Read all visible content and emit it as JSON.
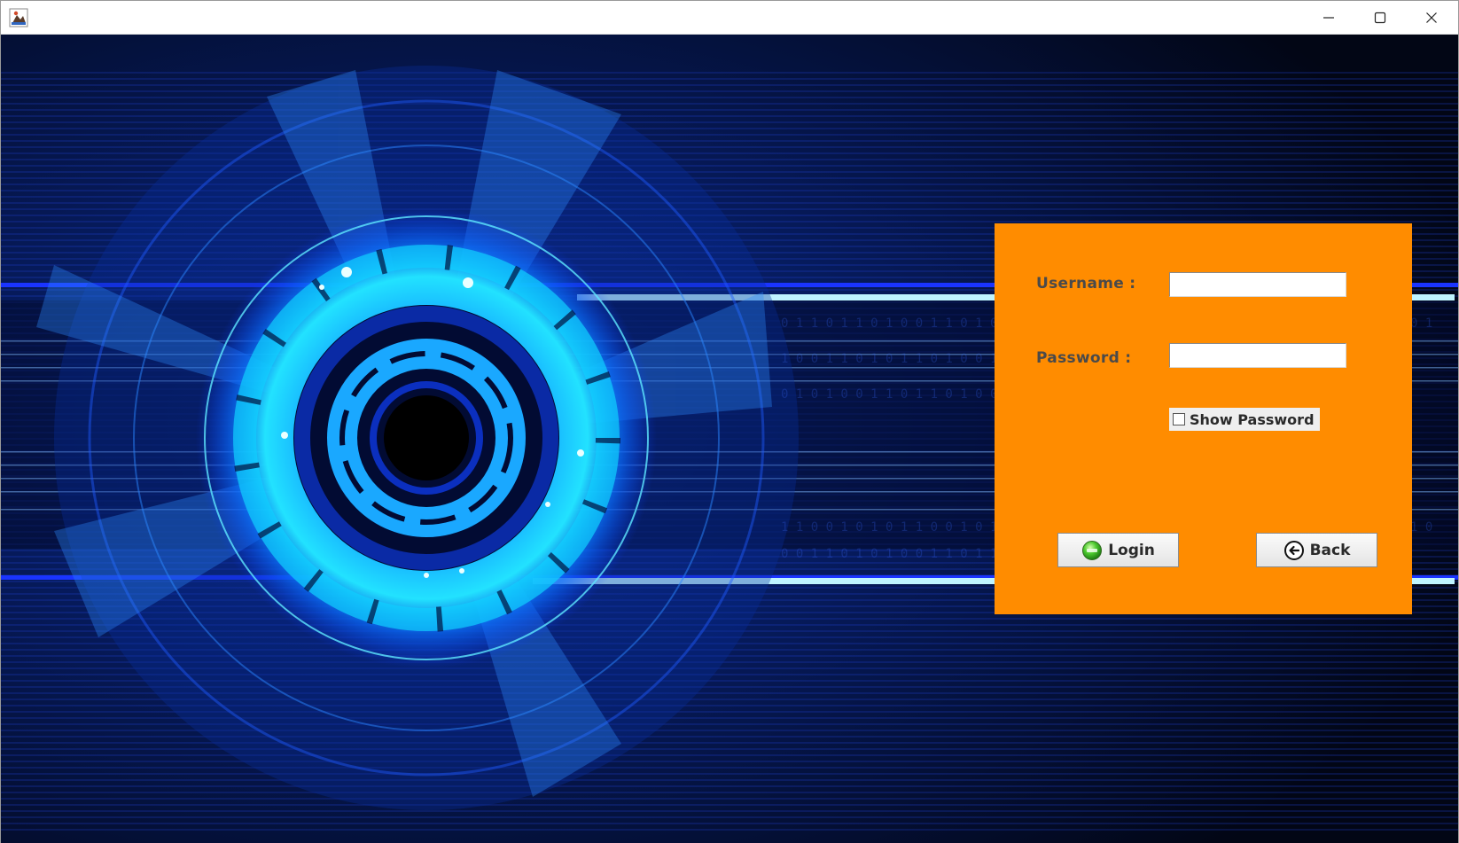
{
  "window": {
    "title": "",
    "icons": {
      "app": "java-app-icon",
      "minimize": "minimize-icon",
      "maximize": "maximize-icon",
      "close": "close-icon"
    }
  },
  "background": {
    "description_icon": "circular-tech-background",
    "colors": {
      "deep": "#03060f",
      "blue": "#0a3cff",
      "cyan": "#25e6ff"
    }
  },
  "login": {
    "panel_color": "#ff8c00",
    "username_label": "Username :",
    "username_value": "",
    "password_label": "Password :",
    "password_value": "",
    "show_password_label": "Show Password",
    "show_password_checked": false,
    "login_button": "Login",
    "login_icon": "green-circle-icon",
    "back_button": "Back",
    "back_icon": "back-arrow-icon"
  }
}
